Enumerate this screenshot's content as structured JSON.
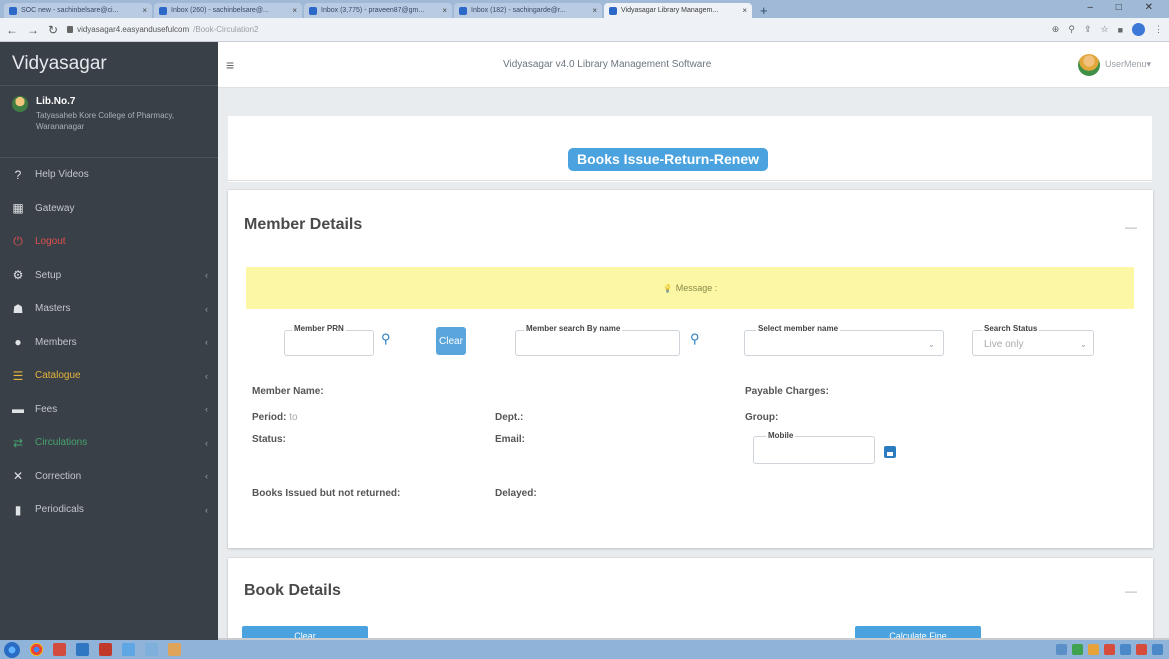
{
  "browser": {
    "tabs": [
      {
        "label": "SOC new - sachinbelsare@ci...",
        "active": false
      },
      {
        "label": "Inbox (260) - sachinbelsare@...",
        "active": false
      },
      {
        "label": "Inbox (3,775) - praveen87@gm...",
        "active": false
      },
      {
        "label": "Inbox (182) - sachingarde@r...",
        "active": false
      },
      {
        "label": "Vidyasagar Library Managem...",
        "active": true
      }
    ],
    "new_tab": "+",
    "url_host": "vidyasagar4.easyandusefulcom",
    "url_path": "/Book-Circulation2",
    "window_controls": "– □ ✕"
  },
  "sidebar": {
    "brand": "Vidyasagar",
    "user": {
      "name": "Lib.No.7",
      "institution": "Tatyasaheb Kore College of Pharmacy, Warananagar"
    },
    "items": [
      {
        "label": "Help Videos",
        "icon": "question-icon",
        "glyph": "?",
        "chevron": ""
      },
      {
        "label": "Gateway",
        "icon": "gateway-icon",
        "glyph": "▦",
        "chevron": ""
      },
      {
        "label": "Logout",
        "icon": "power-icon",
        "glyph": "⏻",
        "chevron": ""
      },
      {
        "label": "Setup",
        "icon": "gear-icon",
        "glyph": "⚙",
        "chevron": "‹"
      },
      {
        "label": "Masters",
        "icon": "sitemap-icon",
        "glyph": "☗",
        "chevron": "‹"
      },
      {
        "label": "Members",
        "icon": "user-icon",
        "glyph": "●",
        "chevron": "‹"
      },
      {
        "label": "Catalogue",
        "icon": "list-icon",
        "glyph": "☰",
        "chevron": "‹"
      },
      {
        "label": "Fees",
        "icon": "money-icon",
        "glyph": "▬",
        "chevron": "‹"
      },
      {
        "label": "Circulations",
        "icon": "exchange-icon",
        "glyph": "⇄",
        "chevron": "‹"
      },
      {
        "label": "Correction",
        "icon": "tools-icon",
        "glyph": "✕",
        "chevron": "‹"
      },
      {
        "label": "Periodicals",
        "icon": "book-icon",
        "glyph": "▮",
        "chevron": "‹"
      }
    ]
  },
  "header": {
    "hamburger": "≡",
    "title": "Vidyasagar v4.0 Library Management Software",
    "user_menu": "UserMenu▾"
  },
  "page": {
    "badge": "Books Issue-Return-Renew"
  },
  "member_details": {
    "title": "Member Details",
    "collapse": "—",
    "message_icon": "💡",
    "message_label": "Message :",
    "fields": {
      "prn_label": "Member PRN",
      "clear_button": "Clear",
      "search_name_label": "Member search By name",
      "select_name_label": "Select member name",
      "search_status_label": "Search Status",
      "search_status_value": "Live only",
      "mobile_label": "Mobile"
    },
    "info": {
      "member_name": "Member Name:",
      "payable_charges": "Payable Charges:",
      "period": "Period:",
      "period_value": "to",
      "dept": "Dept.:",
      "group": "Group:",
      "status": "Status:",
      "email": "Email:",
      "books_issued": "Books Issued but not returned:",
      "delayed": "Delayed:"
    }
  },
  "book_details": {
    "title": "Book Details",
    "collapse": "—",
    "clear_button": "Clear",
    "calculate_fine_button": "Calculate Fine"
  },
  "colors": {
    "sidebar_bg": "#3a4047",
    "accent": "#4aa3df",
    "message_bg": "#fbf7a5",
    "logout": "#e15050",
    "catalogue": "#e6b53c",
    "circulations": "#47a36f"
  }
}
